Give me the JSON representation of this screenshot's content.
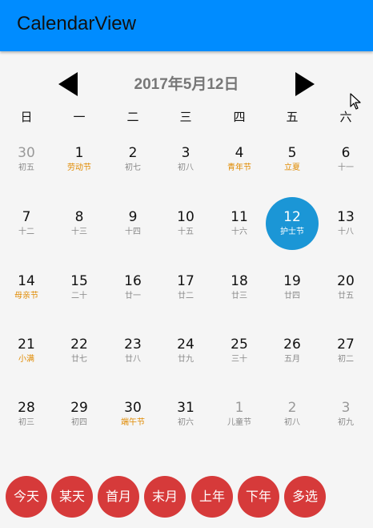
{
  "app": {
    "title": "CalendarView"
  },
  "header": {
    "month_title": "2017年5月12日"
  },
  "weekdays": [
    "日",
    "一",
    "二",
    "三",
    "四",
    "五",
    "六"
  ],
  "colors": {
    "appbar": "#008cff",
    "selected": "#1b96d6",
    "festival": "#e08a00",
    "button": "#d63a3a"
  },
  "days": [
    {
      "num": "30",
      "sub": "初五",
      "other": true
    },
    {
      "num": "1",
      "sub": "劳动节",
      "festival": true
    },
    {
      "num": "2",
      "sub": "初七"
    },
    {
      "num": "3",
      "sub": "初八"
    },
    {
      "num": "4",
      "sub": "青年节",
      "festival": true
    },
    {
      "num": "5",
      "sub": "立夏",
      "festival": true
    },
    {
      "num": "6",
      "sub": "十一"
    },
    {
      "num": "7",
      "sub": "十二"
    },
    {
      "num": "8",
      "sub": "十三"
    },
    {
      "num": "9",
      "sub": "十四"
    },
    {
      "num": "10",
      "sub": "十五"
    },
    {
      "num": "11",
      "sub": "十六"
    },
    {
      "num": "12",
      "sub": "护士节",
      "selected": true
    },
    {
      "num": "13",
      "sub": "十八"
    },
    {
      "num": "14",
      "sub": "母亲节",
      "festival": true
    },
    {
      "num": "15",
      "sub": "二十"
    },
    {
      "num": "16",
      "sub": "廿一"
    },
    {
      "num": "17",
      "sub": "廿二"
    },
    {
      "num": "18",
      "sub": "廿三"
    },
    {
      "num": "19",
      "sub": "廿四"
    },
    {
      "num": "20",
      "sub": "廿五"
    },
    {
      "num": "21",
      "sub": "小满",
      "festival": true
    },
    {
      "num": "22",
      "sub": "廿七"
    },
    {
      "num": "23",
      "sub": "廿八"
    },
    {
      "num": "24",
      "sub": "廿九"
    },
    {
      "num": "25",
      "sub": "三十"
    },
    {
      "num": "26",
      "sub": "五月"
    },
    {
      "num": "27",
      "sub": "初二"
    },
    {
      "num": "28",
      "sub": "初三"
    },
    {
      "num": "29",
      "sub": "初四"
    },
    {
      "num": "30",
      "sub": "端午节",
      "festival": true
    },
    {
      "num": "31",
      "sub": "初六"
    },
    {
      "num": "1",
      "sub": "儿童节",
      "other": true
    },
    {
      "num": "2",
      "sub": "初八",
      "other": true
    },
    {
      "num": "3",
      "sub": "初九",
      "other": true
    }
  ],
  "buttons": [
    "今天",
    "某天",
    "首月",
    "末月",
    "上年",
    "下年",
    "多选"
  ]
}
